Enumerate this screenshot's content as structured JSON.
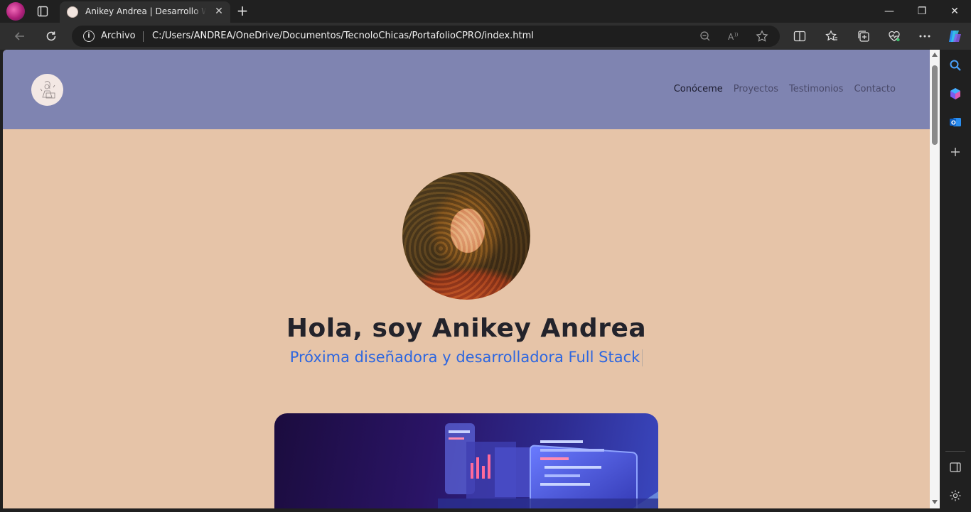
{
  "browser": {
    "tab": {
      "title": "Anikey Andrea | Desarrollo Web Full Stack",
      "close_glyph": "✕"
    },
    "new_tab_glyph": "+",
    "window_controls": {
      "minimize": "—",
      "maximize": "❐",
      "close": "✕"
    },
    "address": {
      "scheme_label": "Archivo",
      "url": "C:/Users/ANDREA/OneDrive/Documentos/TecnoloChicas/PortafolioCPRO/index.html"
    }
  },
  "site": {
    "nav": [
      {
        "label": "Conóceme"
      },
      {
        "label": "Proyectos"
      },
      {
        "label": "Testimonios"
      },
      {
        "label": "Contacto"
      }
    ],
    "hero": {
      "greeting": "Hola, soy Anikey Andrea",
      "subtitle": "Próxima diseñadora y desarrolladora Full Stack"
    }
  },
  "colors": {
    "header_bg": "#7f84b1",
    "page_bg": "#e6c4a8",
    "subtitle": "#2d66e0",
    "greeting": "#23232b"
  }
}
